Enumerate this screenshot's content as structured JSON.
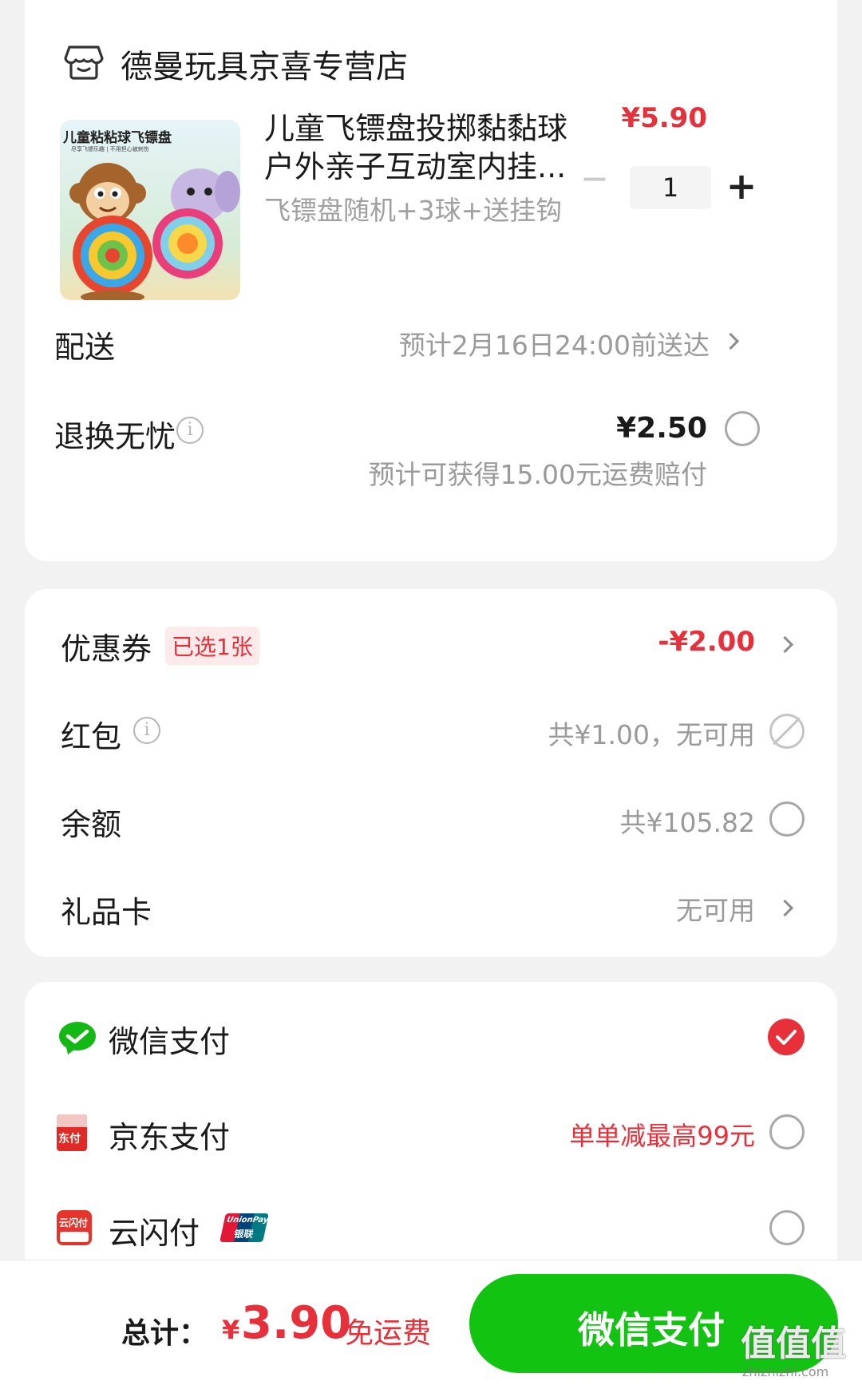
{
  "store": {
    "name": "德曼玩具京喜专营店",
    "icon": "store-icon"
  },
  "product": {
    "thumb_banner": "儿童粘粘球飞镖盘",
    "thumb_sub": "尽享飞镖乐趣 | 不用担心被刺伤",
    "title_line1": "儿童飞镖盘投掷黏黏球",
    "title_line2": "户外亲子互动室内挂...",
    "variant": "飞镖盘随机+3球+送挂钩",
    "price": "¥5.90",
    "quantity": "1",
    "minus": "—",
    "plus": "+"
  },
  "delivery": {
    "label": "配送",
    "value": "预计2月16日24:00前送达"
  },
  "return_insurance": {
    "label": "退换无忧",
    "price": "¥2.50",
    "note": "预计可获得15.00元运费赔付"
  },
  "coupon": {
    "label": "优惠券",
    "badge": "已选1张",
    "value": "-¥2.00"
  },
  "red_packet": {
    "label": "红包",
    "value": "共¥1.00，无可用"
  },
  "balance": {
    "label": "余额",
    "value": "共¥105.82"
  },
  "gift_card": {
    "label": "礼品卡",
    "value": "无可用"
  },
  "payment": {
    "wechat": {
      "label": "微信支付",
      "selected": true,
      "icon": "wechat-pay-icon"
    },
    "jd": {
      "label": "京东支付",
      "promo": "单单减最高99元",
      "icon_text": "东付",
      "icon": "jd-pay-icon"
    },
    "unionpay": {
      "label": "云闪付",
      "icon_text": "云闪付",
      "badge_text_top": "UnionPay",
      "badge_text_bottom": "银联",
      "icon": "unionpay-icon"
    }
  },
  "footer": {
    "total_label": "总计：",
    "currency": "¥",
    "total": "3.90",
    "shipping": "免运费",
    "pay_button": "微信支付",
    "watermark": "值值值",
    "watermark_url": "zhizhizhi.com"
  },
  "colors": {
    "accent_red": "#e8303a",
    "wechat_green": "#14b814",
    "pay_button_green": "#12c312"
  }
}
